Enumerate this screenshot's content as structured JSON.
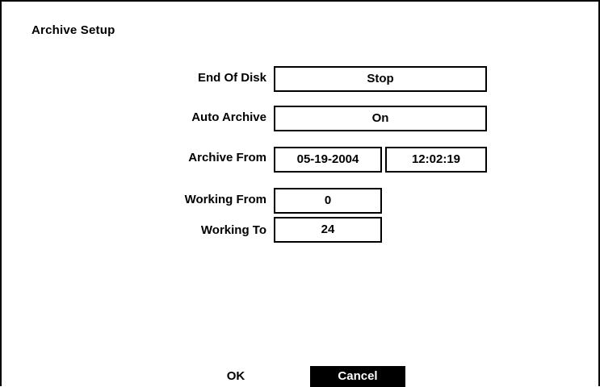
{
  "dialog": {
    "title": "Archive Setup"
  },
  "fields": {
    "end_of_disk": {
      "label": "End Of Disk",
      "value": "Stop"
    },
    "auto_archive": {
      "label": "Auto Archive",
      "value": "On"
    },
    "archive_from": {
      "label": "Archive From",
      "date": "05-19-2004",
      "time": "12:02:19"
    },
    "working_from": {
      "label": "Working From",
      "value": "0"
    },
    "working_to": {
      "label": "Working To",
      "value": "24"
    }
  },
  "buttons": {
    "ok": "OK",
    "cancel": "Cancel"
  },
  "colors": {
    "background": "#ffffff",
    "foreground": "#000000",
    "selected_button_bg": "#000000",
    "selected_button_text": "#ffffff"
  }
}
